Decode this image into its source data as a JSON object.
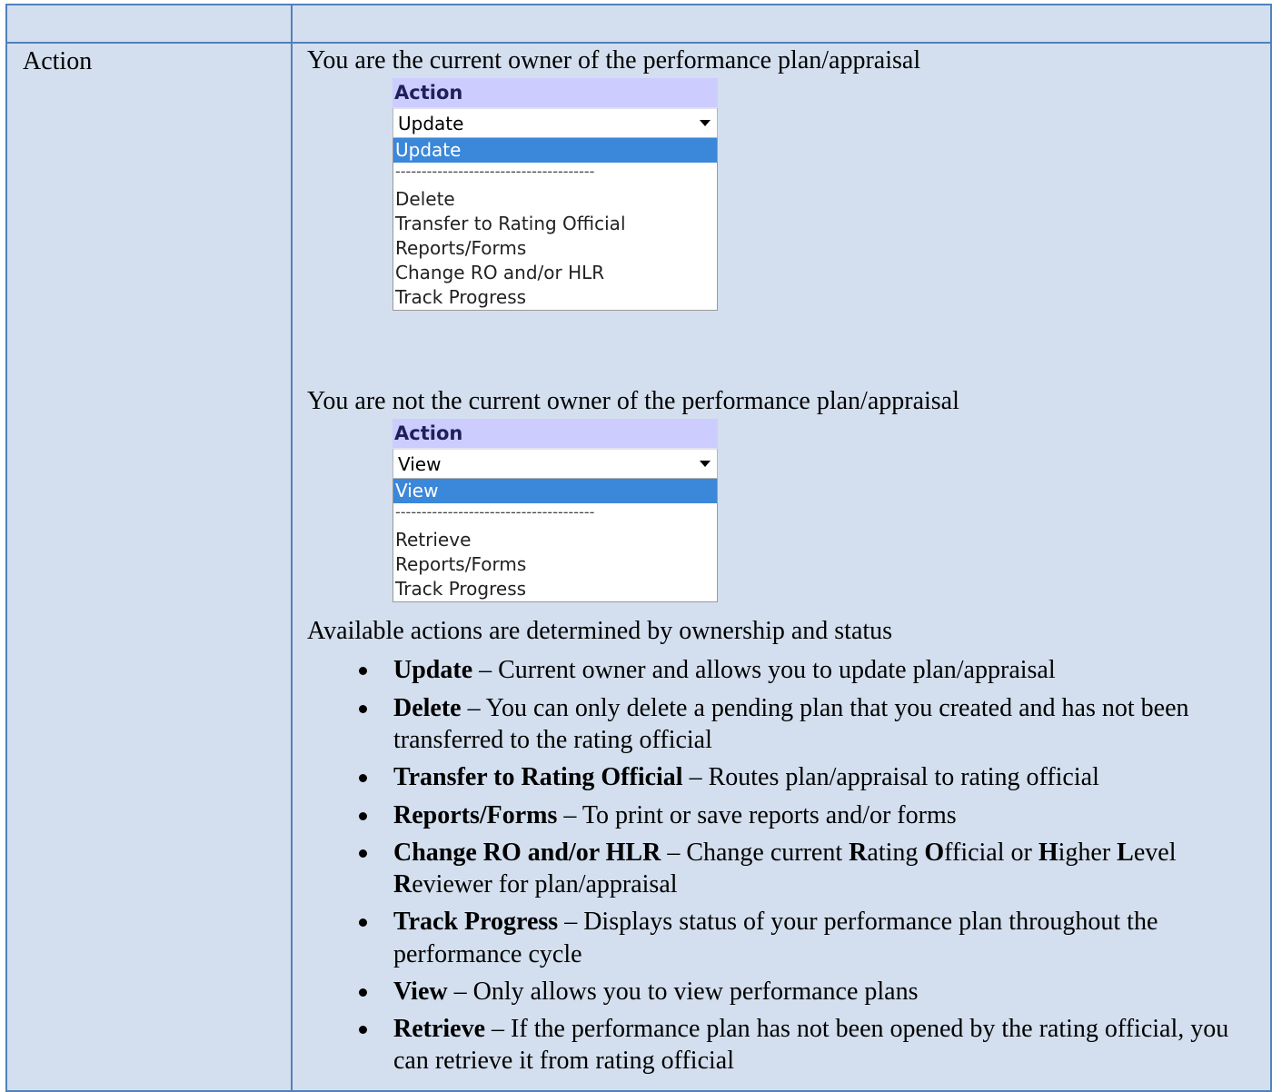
{
  "row_label": "Action",
  "section1": {
    "intro": "You are the current owner of the performance plan/appraisal",
    "dropdown": {
      "header": "Action",
      "selected": "Update",
      "items": [
        "Update",
        "--------------------------------------",
        "Delete",
        "Transfer to Rating Official",
        "Reports/Forms",
        "Change RO and/or HLR",
        "Track Progress"
      ]
    }
  },
  "section2": {
    "intro": "You are not the current owner of the performance plan/appraisal",
    "dropdown": {
      "header": "Action",
      "selected": "View",
      "items": [
        "View",
        "--------------------------------------",
        "Retrieve",
        "Reports/Forms",
        "Track Progress"
      ]
    }
  },
  "available": {
    "intro": "Available actions are determined by ownership and status",
    "items": [
      {
        "term": "Update",
        "desc": " – Current owner and allows you to update plan/appraisal"
      },
      {
        "term": "Delete",
        "desc": " – You can only delete a pending plan that you created and has not been transferred to the rating official"
      },
      {
        "term": "Transfer to Rating Official",
        "desc": " – Routes plan/appraisal to rating official"
      },
      {
        "term": "Reports/Forms",
        "desc": " – To print or save reports and/or forms"
      },
      {
        "term": "Change RO and/or HLR",
        "desc_parts": [
          {
            "t": " – Change current ",
            "b": false
          },
          {
            "t": "R",
            "b": true
          },
          {
            "t": "ating ",
            "b": false
          },
          {
            "t": "O",
            "b": true
          },
          {
            "t": "fficial or ",
            "b": false
          },
          {
            "t": "H",
            "b": true
          },
          {
            "t": "igher ",
            "b": false
          },
          {
            "t": "L",
            "b": true
          },
          {
            "t": "evel ",
            "b": false
          },
          {
            "t": "R",
            "b": true
          },
          {
            "t": "eviewer for plan/appraisal",
            "b": false
          }
        ]
      },
      {
        "term": "Track Progress",
        "desc": " – Displays status of your performance plan throughout the performance cycle"
      },
      {
        "term": "View",
        "desc": " – Only allows you to view performance plans"
      },
      {
        "term": "Retrieve",
        "desc": " – If the performance plan has not been opened by the rating official, you can retrieve it from rating official"
      }
    ]
  }
}
